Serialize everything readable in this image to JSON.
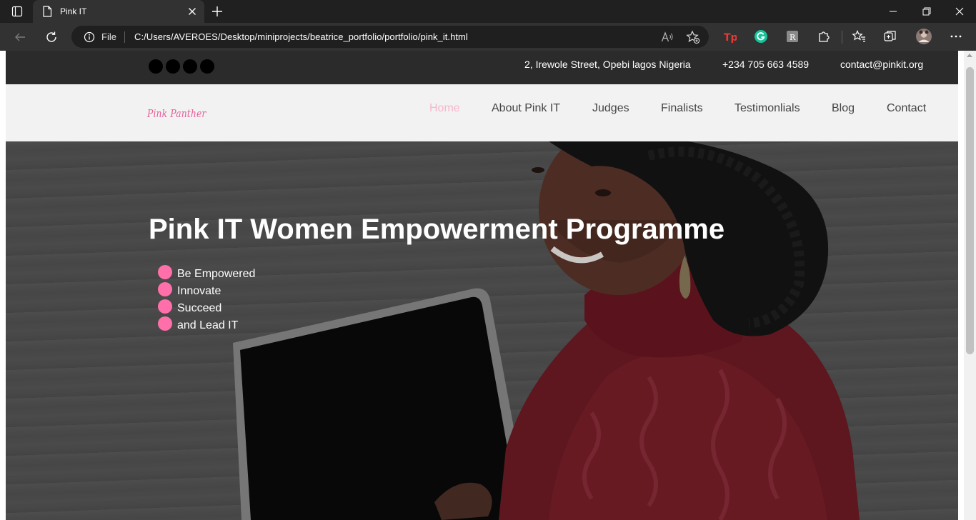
{
  "browser": {
    "tab_title": "Pink IT",
    "address_scheme": "File",
    "address_url": "C:/Users/AVEROES/Desktop/miniprojects/beatrice_portfolio/portfolio/pink_it.html"
  },
  "topbar": {
    "social_icons": [
      "social-icon-1",
      "social-icon-2",
      "social-icon-3",
      "social-icon-4"
    ],
    "address": "2, Irewole Street, Opebi lagos Nigeria",
    "phone": "+234 705 663 4589",
    "email": "contact@pinkit.org"
  },
  "navbar": {
    "logo": "Pink Panther",
    "items": [
      {
        "label": "Home",
        "active": true
      },
      {
        "label": "About Pink IT",
        "active": false
      },
      {
        "label": "Judges",
        "active": false
      },
      {
        "label": "Finalists",
        "active": false
      },
      {
        "label": "Testimonlials",
        "active": false
      },
      {
        "label": "Blog",
        "active": false
      },
      {
        "label": "Contact",
        "active": false
      }
    ]
  },
  "hero": {
    "title": "Pink IT Women Empowerment Programme",
    "bullets": [
      "Be Empowered",
      "Innovate",
      "Succeed",
      "and Lead IT"
    ]
  },
  "colors": {
    "accent_pink": "#ff6fa9",
    "nav_active": "#f8b6ce",
    "logo": "#e75f98",
    "topbar_bg": "#2b2b2b",
    "navbar_bg": "#f2f2f2"
  }
}
